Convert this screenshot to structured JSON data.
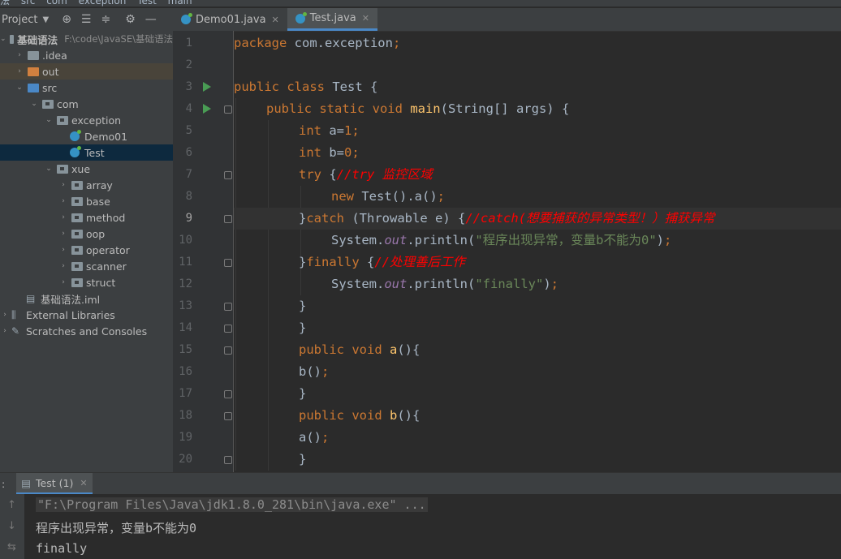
{
  "breadcrumbs": [
    "法",
    "src",
    "com",
    "exception",
    "Test",
    "main"
  ],
  "project_panel": {
    "title": "Project",
    "icons": [
      "globe-icon",
      "expand-all-icon",
      "collapse-all-icon",
      "gear-icon",
      "minimize-icon"
    ],
    "tree": [
      {
        "label": "基础语法",
        "path": "F:\\code\\JavaSE\\基础语法",
        "type": "module",
        "depth": 0,
        "expanded": true
      },
      {
        "label": ".idea",
        "type": "folder",
        "depth": 1,
        "expanded": false
      },
      {
        "label": "out",
        "type": "folder-orange",
        "depth": 1,
        "expanded": false,
        "highlighted": true
      },
      {
        "label": "src",
        "type": "folder-blue",
        "depth": 1,
        "expanded": true
      },
      {
        "label": "com",
        "type": "package",
        "depth": 2,
        "expanded": true
      },
      {
        "label": "exception",
        "type": "package",
        "depth": 3,
        "expanded": true
      },
      {
        "label": "Demo01",
        "type": "class",
        "depth": 4
      },
      {
        "label": "Test",
        "type": "class",
        "depth": 4,
        "selected": true
      },
      {
        "label": "xue",
        "type": "package",
        "depth": 3,
        "expanded": true
      },
      {
        "label": "array",
        "type": "package",
        "depth": 4,
        "expanded": false
      },
      {
        "label": "base",
        "type": "package",
        "depth": 4,
        "expanded": false
      },
      {
        "label": "method",
        "type": "package",
        "depth": 4,
        "expanded": false
      },
      {
        "label": "oop",
        "type": "package",
        "depth": 4,
        "expanded": false
      },
      {
        "label": "operator",
        "type": "package",
        "depth": 4,
        "expanded": false
      },
      {
        "label": "scanner",
        "type": "package",
        "depth": 4,
        "expanded": false
      },
      {
        "label": "struct",
        "type": "package",
        "depth": 4,
        "expanded": false
      },
      {
        "label": "基础语法.iml",
        "type": "file",
        "depth": 1
      },
      {
        "label": "External Libraries",
        "type": "libs",
        "depth": 0,
        "expanded": false
      },
      {
        "label": "Scratches and Consoles",
        "type": "scratch",
        "depth": 0,
        "expanded": false
      }
    ]
  },
  "editor_tabs": [
    {
      "label": "Demo01.java",
      "active": false
    },
    {
      "label": "Test.java",
      "active": true
    }
  ],
  "editor": {
    "current_line": 9,
    "run_markers": [
      3,
      4
    ],
    "lines": [
      {
        "n": "1",
        "indent": 0,
        "tokens": [
          {
            "t": "package ",
            "c": "kw"
          },
          {
            "t": "com.exception",
            "c": ""
          },
          {
            "t": ";",
            "c": "kw"
          }
        ]
      },
      {
        "n": "2",
        "indent": 0,
        "tokens": []
      },
      {
        "n": "3",
        "indent": 0,
        "tokens": [
          {
            "t": "public class ",
            "c": "kw"
          },
          {
            "t": "Test {",
            "c": ""
          }
        ]
      },
      {
        "n": "4",
        "indent": 1,
        "tokens": [
          {
            "t": "public static void ",
            "c": "kw"
          },
          {
            "t": "main",
            "c": "fn"
          },
          {
            "t": "(String[] args) {",
            "c": ""
          }
        ]
      },
      {
        "n": "5",
        "indent": 2,
        "tokens": [
          {
            "t": "int ",
            "c": "kw"
          },
          {
            "t": "a",
            "c": ""
          },
          {
            "t": "=",
            "c": ""
          },
          {
            "t": "1",
            "c": "kw"
          },
          {
            "t": ";",
            "c": "kw"
          }
        ]
      },
      {
        "n": "6",
        "indent": 2,
        "tokens": [
          {
            "t": "int ",
            "c": "kw"
          },
          {
            "t": "b",
            "c": ""
          },
          {
            "t": "=",
            "c": ""
          },
          {
            "t": "0",
            "c": "kw"
          },
          {
            "t": ";",
            "c": "kw"
          }
        ]
      },
      {
        "n": "7",
        "indent": 2,
        "tokens": [
          {
            "t": "try ",
            "c": "kw"
          },
          {
            "t": "{",
            "c": ""
          },
          {
            "t": "//try 监控区域",
            "c": "cm"
          }
        ]
      },
      {
        "n": "8",
        "indent": 3,
        "tokens": [
          {
            "t": "new ",
            "c": "kw"
          },
          {
            "t": "Test().a()",
            "c": ""
          },
          {
            "t": ";",
            "c": "kw"
          }
        ]
      },
      {
        "n": "9",
        "indent": 2,
        "tokens": [
          {
            "t": "}",
            "c": ""
          },
          {
            "t": "catch ",
            "c": "kw"
          },
          {
            "t": "(Throwable e) {",
            "c": ""
          },
          {
            "t": "//catch(想要捕获的异常类型！）捕获异常",
            "c": "cm"
          }
        ]
      },
      {
        "n": "10",
        "indent": 3,
        "tokens": [
          {
            "t": "System.",
            "c": ""
          },
          {
            "t": "out",
            "c": "fld"
          },
          {
            "t": ".println(",
            "c": ""
          },
          {
            "t": "\"程序出现异常，变量b不能为0\"",
            "c": "st"
          },
          {
            "t": ")",
            "c": ""
          },
          {
            "t": ";",
            "c": "kw"
          }
        ]
      },
      {
        "n": "11",
        "indent": 2,
        "tokens": [
          {
            "t": "}",
            "c": ""
          },
          {
            "t": "finally ",
            "c": "kw"
          },
          {
            "t": "{",
            "c": ""
          },
          {
            "t": "//处理善后工作",
            "c": "cm"
          }
        ]
      },
      {
        "n": "12",
        "indent": 3,
        "tokens": [
          {
            "t": "System.",
            "c": ""
          },
          {
            "t": "out",
            "c": "fld"
          },
          {
            "t": ".println(",
            "c": ""
          },
          {
            "t": "\"finally\"",
            "c": "st"
          },
          {
            "t": ")",
            "c": ""
          },
          {
            "t": ";",
            "c": "kw"
          }
        ]
      },
      {
        "n": "13",
        "indent": 2,
        "tokens": [
          {
            "t": "}",
            "c": ""
          }
        ]
      },
      {
        "n": "14",
        "indent": 2,
        "tokens": [
          {
            "t": "}",
            "c": ""
          }
        ]
      },
      {
        "n": "15",
        "indent": 2,
        "tokens": [
          {
            "t": "public void ",
            "c": "kw"
          },
          {
            "t": "a",
            "c": "fn"
          },
          {
            "t": "(){",
            "c": ""
          }
        ]
      },
      {
        "n": "16",
        "indent": 2,
        "tokens": [
          {
            "t": "b()",
            "c": ""
          },
          {
            "t": ";",
            "c": "kw"
          }
        ]
      },
      {
        "n": "17",
        "indent": 2,
        "tokens": [
          {
            "t": "}",
            "c": ""
          }
        ]
      },
      {
        "n": "18",
        "indent": 2,
        "tokens": [
          {
            "t": "public void ",
            "c": "kw"
          },
          {
            "t": "b",
            "c": "fn"
          },
          {
            "t": "(){",
            "c": ""
          }
        ]
      },
      {
        "n": "19",
        "indent": 2,
        "tokens": [
          {
            "t": "a()",
            "c": ""
          },
          {
            "t": ";",
            "c": "kw"
          }
        ]
      },
      {
        "n": "20",
        "indent": 2,
        "tokens": [
          {
            "t": "}",
            "c": ""
          }
        ]
      }
    ]
  },
  "run_panel": {
    "colon": ":",
    "tab_label": "Test (1)",
    "lines": [
      "\"F:\\Program Files\\Java\\jdk1.8.0_281\\bin\\java.exe\" ...",
      "程序出现异常，变量b不能为0",
      "finally"
    ]
  },
  "colors": {
    "keyword": "#cc7832",
    "comment": "#ff0000",
    "string": "#6a8759",
    "field": "#9876aa",
    "method": "#ffc66d",
    "selection": "#0d293e",
    "accent": "#4a88c7"
  }
}
